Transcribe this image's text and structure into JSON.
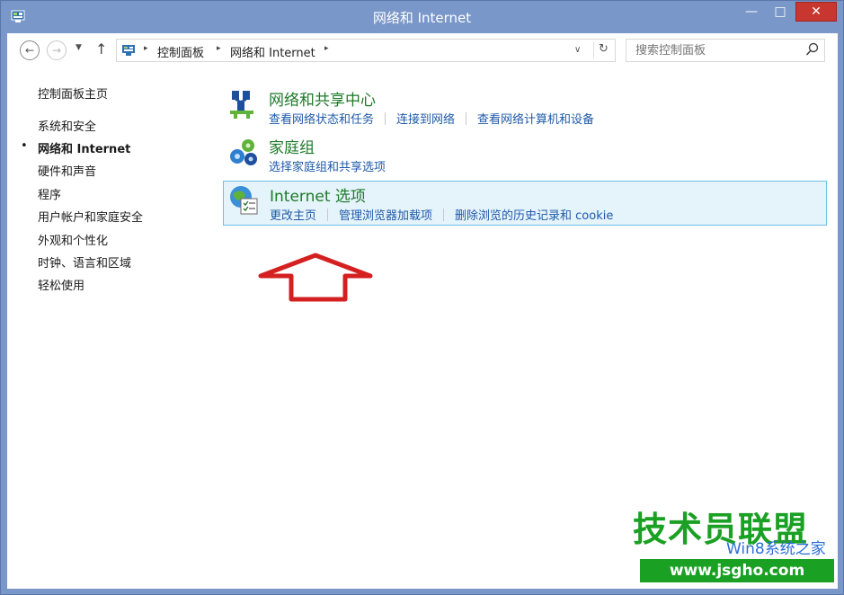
{
  "window": {
    "title": "网络和 Internet",
    "minimize_glyph": "—",
    "maximize_glyph": "□",
    "close_glyph": "✕"
  },
  "nav": {
    "back_glyph": "←",
    "forward_glyph": "→",
    "recent_glyph": "▼",
    "up_glyph": "↑"
  },
  "address": {
    "crumbs": [
      "控制面板",
      "网络和 Internet"
    ],
    "separator": "▸",
    "dropdown_glyph": "∨",
    "refresh_glyph": "↻"
  },
  "search": {
    "placeholder": "搜索控制面板"
  },
  "leftnav": {
    "home": "控制面板主页",
    "active_bullet": "•",
    "items": [
      "系统和安全",
      "网络和 Internet",
      "硬件和声音",
      "程序",
      "用户帐户和家庭安全",
      "外观和个性化",
      "时钟、语言和区域",
      "轻松使用"
    ]
  },
  "categories": [
    {
      "title": "网络和共享中心",
      "icon": "network-sharing-icon",
      "links": [
        "查看网络状态和任务",
        "连接到网络",
        "查看网络计算机和设备"
      ]
    },
    {
      "title": "家庭组",
      "icon": "homegroup-icon",
      "links": [
        "选择家庭组和共享选项"
      ]
    },
    {
      "title": "Internet 选项",
      "icon": "internet-options-icon",
      "links": [
        "更改主页",
        "管理浏览器加载项",
        "删除浏览的历史记录和 cookie"
      ]
    }
  ],
  "watermark": {
    "main": "技术员联盟",
    "sub": "Win8系统之家",
    "url": "www.jsgho.com"
  },
  "colors": {
    "titlebar": "#7a97c9",
    "close_button": "#c7372f",
    "category_title": "#1e7a2a",
    "link": "#1e5aa8",
    "hover_bg": "#e5f3fb",
    "hover_border": "#70c0e7",
    "arrow": "#d42020",
    "watermark_green": "#1aa023"
  }
}
